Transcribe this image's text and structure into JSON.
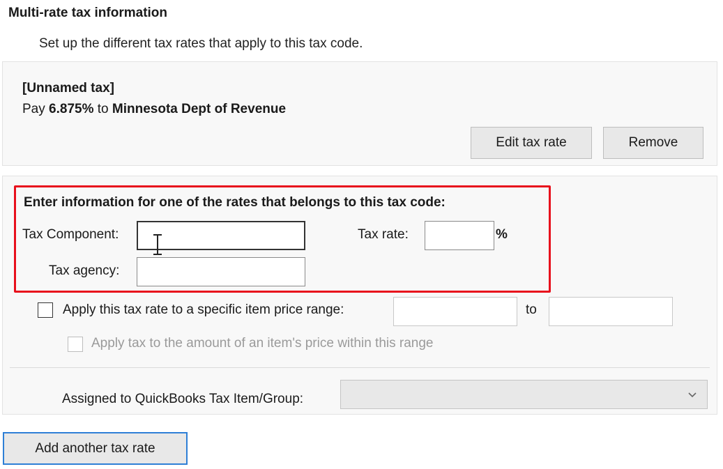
{
  "section": {
    "title": "Multi-rate tax information",
    "description": "Set up the different tax rates that apply to this tax code."
  },
  "existing_tax": {
    "name": "[Unnamed tax]",
    "pay_prefix": "Pay ",
    "rate": "6.875%",
    "to_text": " to ",
    "agency": "Minnesota Dept of Revenue",
    "edit_label": "Edit tax rate",
    "remove_label": "Remove"
  },
  "form": {
    "heading": "Enter information for one of the rates that belongs to this tax code:",
    "component_label": "Tax Component:",
    "component_value": "",
    "agency_label": "Tax agency:",
    "agency_value": "",
    "rate_label": "Tax rate:",
    "rate_value": "",
    "percent_sign": "%",
    "highlight_color": "#e8101c"
  },
  "price_range": {
    "checkbox_label": "Apply this tax rate to a specific item price range:",
    "checked": false,
    "from_value": "",
    "to_label": "to",
    "to_value": "",
    "within_label": "Apply tax to the amount of an item's price within this range",
    "within_enabled": false
  },
  "assignment": {
    "label": "Assigned to QuickBooks Tax Item/Group:",
    "selected_value": ""
  },
  "actions": {
    "add_label": "Add another tax rate",
    "accent_color": "#2e7fd6"
  },
  "icons": {
    "cursor": "text-cursor-icon",
    "dropdown": "chevron-down-icon"
  }
}
